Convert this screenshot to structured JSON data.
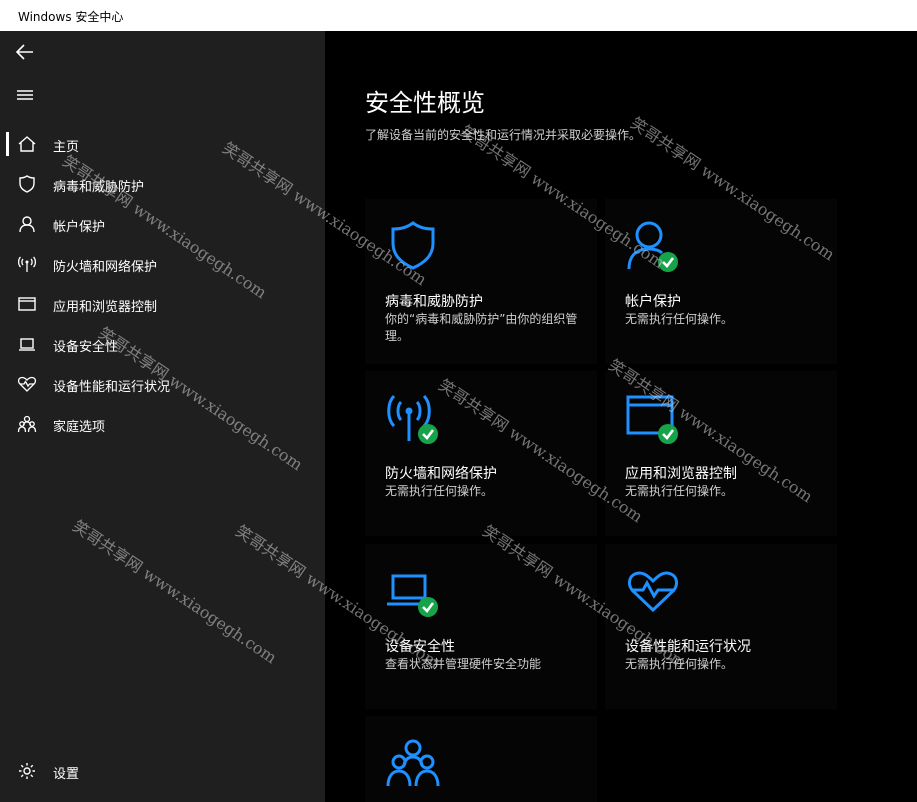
{
  "window": {
    "title": "Windows 安全中心"
  },
  "nav": {
    "items": [
      {
        "label": "主页",
        "icon": "home-icon"
      },
      {
        "label": "病毒和威胁防护",
        "icon": "shield-icon"
      },
      {
        "label": "帐户保护",
        "icon": "person-icon"
      },
      {
        "label": "防火墙和网络保护",
        "icon": "antenna-icon"
      },
      {
        "label": "应用和浏览器控制",
        "icon": "browser-window-icon"
      },
      {
        "label": "设备安全性",
        "icon": "laptop-icon"
      },
      {
        "label": "设备性能和运行状况",
        "icon": "heart-pulse-icon"
      },
      {
        "label": "家庭选项",
        "icon": "family-icon"
      }
    ],
    "settings_label": "设置"
  },
  "main": {
    "title": "安全性概览",
    "subtitle": "了解设备当前的安全性和运行情况并采取必要操作。",
    "tiles": [
      {
        "title": "病毒和威胁防护",
        "desc": "你的“病毒和威胁防护”由你的组织管理。",
        "icon": "shield-icon",
        "status": "managed"
      },
      {
        "title": "帐户保护",
        "desc": "无需执行任何操作。",
        "icon": "person-icon",
        "status": "ok"
      },
      {
        "title": "防火墙和网络保护",
        "desc": "无需执行任何操作。",
        "icon": "antenna-icon",
        "status": "ok"
      },
      {
        "title": "应用和浏览器控制",
        "desc": "无需执行任何操作。",
        "icon": "browser-window-icon",
        "status": "ok"
      },
      {
        "title": "设备安全性",
        "desc": "查看状态并管理硬件安全功能",
        "icon": "laptop-icon",
        "status": "ok"
      },
      {
        "title": "设备性能和运行状况",
        "desc": "无需执行任何操作。",
        "icon": "heart-pulse-icon",
        "status": "none"
      },
      {
        "title": "",
        "desc": "",
        "icon": "family-icon",
        "status": "none"
      }
    ]
  },
  "watermark": {
    "text": "笑哥共享网 www.xiaogegh.com"
  },
  "colors": {
    "accent": "#1e90ff",
    "ok": "#16a34a",
    "sidebar": "#1f1f1f",
    "background": "#000000"
  }
}
